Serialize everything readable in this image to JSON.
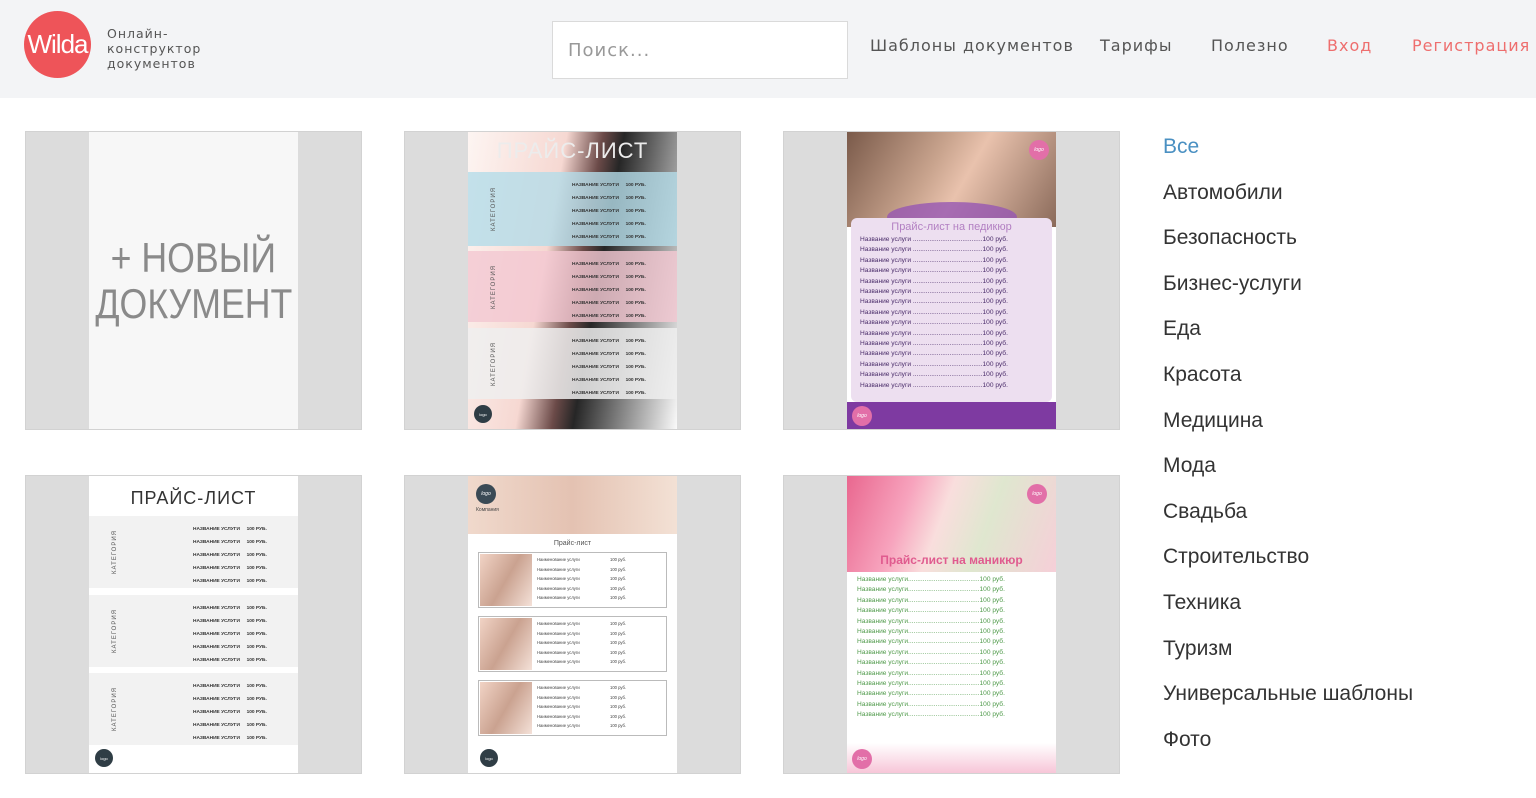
{
  "header": {
    "logo_text": "Wilda",
    "tagline": [
      "Онлайн-",
      "конструктор",
      "документов"
    ],
    "search_placeholder": "Поиск...",
    "nav": {
      "templates": "Шаблоны документов",
      "pricing": "Тарифы",
      "useful": "Полезно",
      "login": "Вход",
      "register": "Регистрация"
    }
  },
  "cards": {
    "new_doc": {
      "line1": "+ НОВЫЙ",
      "line2": "ДОКУМЕНТ"
    },
    "beauty_bands": {
      "title": "ПРАЙС-ЛИСТ",
      "category": "КАТЕГОРИЯ",
      "row": "НАЗВАНИЕ УСЛУГИ     100 РУБ."
    },
    "pedicure": {
      "title": "Прайс-лист на педикюр",
      "row": "Название услуги ......................................100 руб.",
      "logo": "logo"
    },
    "plain": {
      "title": "ПРАЙС-ЛИСТ",
      "category": "КАТЕГОРИЯ",
      "row": "НАЗВАНИЕ УСЛУГИ     100 РУБ."
    },
    "brows": {
      "title": "Прайс-лист",
      "company": "Компания",
      "row": "Наименование услуги                          100 руб.",
      "logo": "logo"
    },
    "manicure": {
      "title": "Прайс-лист на маникюр",
      "row": "Название услуги.......................................100 руб.",
      "logo": "logo"
    }
  },
  "categories": [
    "Все",
    "Автомобили",
    "Безопасность",
    "Бизнес-услуги",
    "Еда",
    "Красота",
    "Медицина",
    "Мода",
    "Свадьба",
    "Строительство",
    "Техника",
    "Туризм",
    "Универсальные шаблоны",
    "Фото"
  ],
  "colors": {
    "brand": "#ee5459",
    "accent_link": "#ee6e6e",
    "active_category": "#4a90c2"
  }
}
